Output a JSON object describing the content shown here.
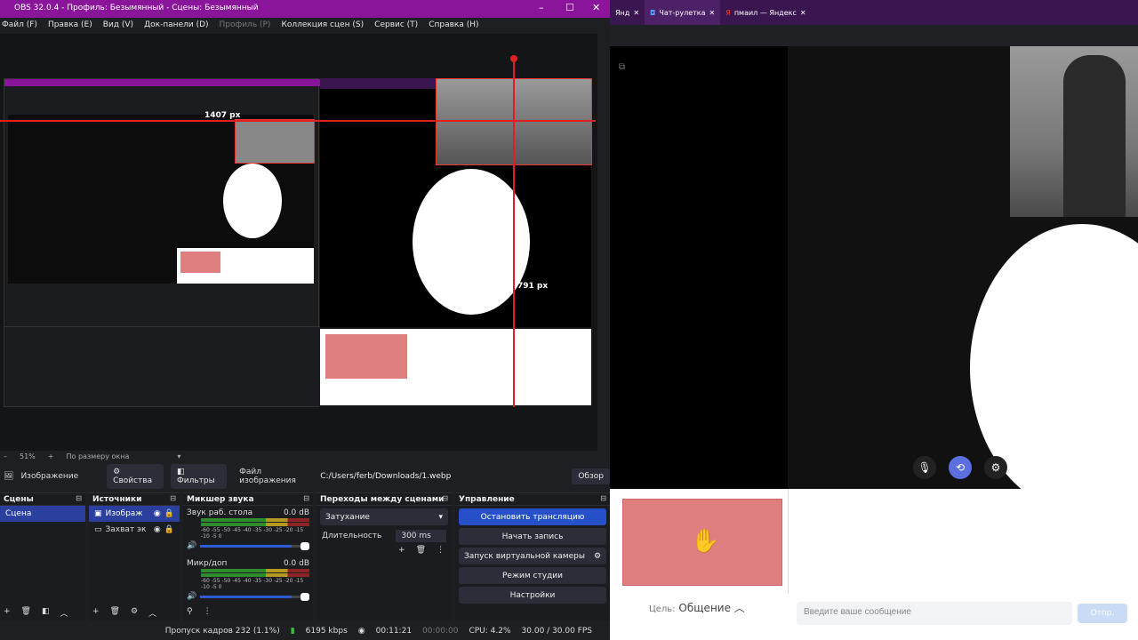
{
  "obs": {
    "title": "OBS 32.0.4 - Профиль: Безымянный - Сцены: Безымянный",
    "menu": [
      "Файл (F)",
      "Правка (E)",
      "Вид (V)",
      "Док-панели (D)",
      "Профиль (P)",
      "Коллекция сцен (S)",
      "Сервис (T)",
      "Справка (H)"
    ],
    "preview": {
      "w_label": "1407 px",
      "h_label": "791 px"
    },
    "zoom": {
      "value": "51%",
      "fit": "По размеру окна"
    },
    "source_bar": {
      "name": "Изображение",
      "properties": "Свойства",
      "filters": "Фильтры",
      "file_label": "Файл изображения",
      "path": "C:/Users/ferb/Downloads/1.webp",
      "browse": "Обзор"
    },
    "docks": {
      "scenes": {
        "title": "Сцены",
        "items": [
          "Сцена"
        ]
      },
      "sources": {
        "title": "Источники",
        "items": [
          "Изображ",
          "Захват эк"
        ]
      },
      "mixer": {
        "title": "Микшер звука",
        "ch1": {
          "name": "Звук раб. стола",
          "db": "0.0 dB"
        },
        "ch2": {
          "name": "Микр/доп",
          "db": "0.0 dB"
        },
        "scale": "-60 -55 -50 -45 -40 -35 -30 -25 -20 -15 -10 -5 0"
      },
      "transitions": {
        "title": "Переходы между сценами",
        "type": "Затухание",
        "duration_label": "Длительность",
        "duration": "300 ms"
      },
      "controls": {
        "title": "Управление",
        "stop": "Остановить трансляцию",
        "record": "Начать запись",
        "vcam": "Запуск виртуальной камеры",
        "studio": "Режим студии",
        "settings": "Настройки"
      }
    },
    "status": {
      "dropped": "Пропуск кадров 232 (1.1%)",
      "kbps": "6195 kbps",
      "stream_time": "00:11:21",
      "rec_time": "00:00:00",
      "cpu": "CPU: 4.2%",
      "fps": "30.00 / 30.00 FPS"
    }
  },
  "browser": {
    "tabs": [
      "Янд",
      "Чат-рулетка",
      "пмаил — Яндекс"
    ],
    "chat": {
      "target_label": "Цель:",
      "target_value": "Общение",
      "input_placeholder": "Введите ваше сообщение",
      "send": "Отпр."
    }
  }
}
